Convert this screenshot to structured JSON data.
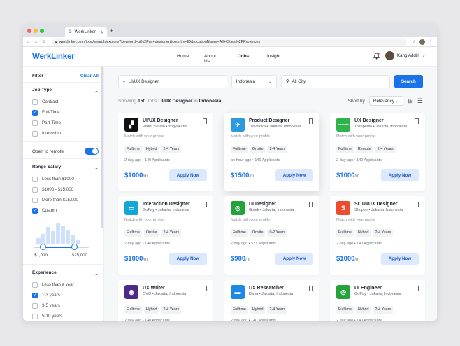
{
  "browser": {
    "tab_title": "WerkLinker",
    "url": "werklinker.com/jobs/search/explore?keyword=ui%2Fux+designer&country=ID&locationName=All+Cities%2FProvinces"
  },
  "header": {
    "logo": "WerkLinker",
    "menu": [
      "Home",
      "About Us",
      "Jobs",
      "Insight"
    ],
    "user_name": "Kang Addin"
  },
  "sidebar": {
    "title": "Filter",
    "clear": "Clear All",
    "job_type": {
      "label": "Job Type",
      "options": [
        {
          "label": "Contract",
          "checked": false
        },
        {
          "label": "Full-Time",
          "checked": true
        },
        {
          "label": "Part-Time",
          "checked": false
        },
        {
          "label": "Internship",
          "checked": false
        }
      ]
    },
    "open_remote": {
      "label": "Open to remote",
      "on": true
    },
    "salary": {
      "label": "Range Salary",
      "options": [
        {
          "label": "Less than $1000",
          "checked": false
        },
        {
          "label": "$1000 - $15,000",
          "checked": false
        },
        {
          "label": "More than $15,000",
          "checked": false
        },
        {
          "label": "Custom",
          "checked": true
        }
      ],
      "min": "$1,000",
      "max": "$25,000"
    },
    "experience": {
      "label": "Experience",
      "options": [
        {
          "label": "Less than a year",
          "checked": false
        },
        {
          "label": "1-3 years",
          "checked": true
        },
        {
          "label": "3-5 years",
          "checked": false
        },
        {
          "label": "5-10 years",
          "checked": false
        }
      ]
    }
  },
  "search": {
    "keyword": "UI/UX Designer",
    "country": "Indonesia",
    "city": "All City",
    "button": "Search"
  },
  "results": {
    "showing": "Showing",
    "count": "150",
    "jobs_word": "Jobs",
    "query": "UI/UX Designer",
    "in_word": "in",
    "location": "Indonesia",
    "sort_label": "Short by",
    "sort_value": "Relevancy"
  },
  "jobs": [
    {
      "title": "UI/UX Designer",
      "company": "Pixelz Studio • Yogyakarta",
      "match": "Match with your profile",
      "tags": [
        "Fulltime",
        "Hybrid",
        "2-4 Years"
      ],
      "posted": "2 day ago • 140 Applicants",
      "salary": "$1000",
      "unit": "/m",
      "apply": "Apply Now",
      "logo_color": "#111111",
      "logo_text": "▞"
    },
    {
      "title": "Product Designer",
      "company": "Traveloka • Jakarta, Indonesia",
      "match": "Match with your profile",
      "tags": [
        "Fulltime",
        "Onsite",
        "2-4 Years"
      ],
      "posted": "an hour ago • 140 Applicants",
      "salary": "$1500",
      "unit": "/m",
      "apply": "Apply Now",
      "logo_color": "#2d9ae0",
      "logo_text": "✈"
    },
    {
      "title": "UX Designer",
      "company": "Tokopedia • Jakarta, Indonesia",
      "match": "Match with your profile",
      "tags": [
        "Fulltime",
        "Remote",
        "2-4 Years"
      ],
      "posted": "2 day ago • 140 Applicants",
      "salary": "$1000",
      "unit": "/m",
      "apply": "Apply Now",
      "logo_color": "#2fb34a",
      "logo_text": "tokopedia"
    },
    {
      "title": "Interaction Designer",
      "company": "GoPay • Jakarta, Indonesia",
      "match": "Match with your profile",
      "tags": [
        "Fulltime",
        "Onsite",
        "2-4 Years"
      ],
      "posted": "2 day ago • 140 Applicants",
      "salary": "$1000",
      "unit": "/m",
      "apply": "Apply Now",
      "logo_color": "#13a6d6",
      "logo_text": "▭"
    },
    {
      "title": "UI Designer",
      "company": "Gojek • Jakarta, Indonesia",
      "match": "Match with your profile",
      "tags": [
        "Fulltime",
        "Onsite",
        "0-2 Years"
      ],
      "posted": "2 day ago • 521 Applicants",
      "salary": "$900",
      "unit": "/m",
      "apply": "Apply Now",
      "logo_color": "#22a33c",
      "logo_text": "◎"
    },
    {
      "title": "Sr. UI/UX Designer",
      "company": "Shopee • Jakarta, Indonesia",
      "match": "Match with your profile",
      "tags": [
        "Fulltime",
        "Hybrid",
        "2-4 Years"
      ],
      "posted": "2 day ago • 140 Applicants",
      "salary": "$1000",
      "unit": "/m",
      "apply": "Apply Now",
      "logo_color": "#ee4d2d",
      "logo_text": "S"
    },
    {
      "title": "UX Writer",
      "company": "OVO • Jakarta, Indonesia",
      "match": "",
      "tags": [
        "Fulltime",
        "Hybrid",
        "2-4 Years"
      ],
      "posted": "2 day ago • 140 Applicants",
      "salary": "",
      "unit": "",
      "apply": "",
      "logo_color": "#4c2a86",
      "logo_text": "◉"
    },
    {
      "title": "UX Researcher",
      "company": "Dana • Jakarta, Indonesia",
      "match": "",
      "tags": [
        "Fulltime",
        "Hybrid",
        "2-4 Years"
      ],
      "posted": "2 day ago • 140 Applicants",
      "salary": "",
      "unit": "",
      "apply": "",
      "logo_color": "#1e88e5",
      "logo_text": "▬"
    },
    {
      "title": "UI Engineer",
      "company": "GoPay • Jakarta, Indonesia",
      "match": "",
      "tags": [
        "Fulltime",
        "Hybrid",
        "2-4 Years"
      ],
      "posted": "2 day ago • 140 Applicants",
      "salary": "",
      "unit": "",
      "apply": "",
      "logo_color": "#22a33c",
      "logo_text": "◎"
    }
  ],
  "colors": {
    "accent": "#1a73e8"
  }
}
